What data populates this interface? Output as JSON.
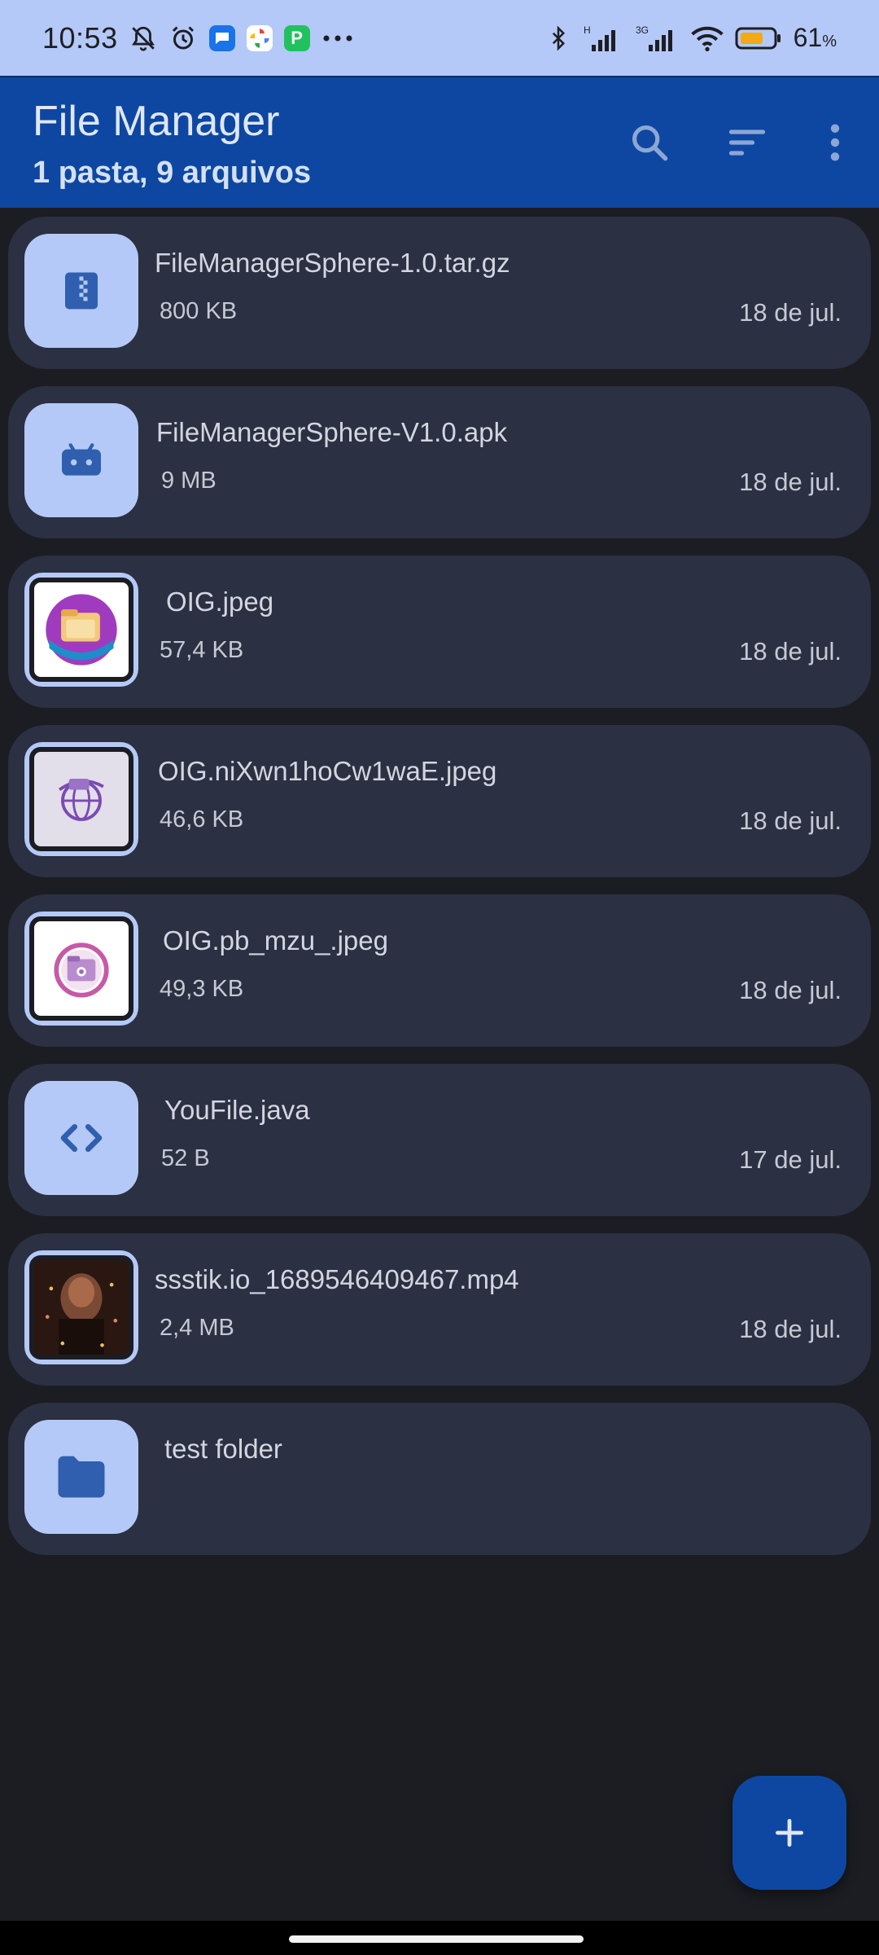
{
  "status_bar": {
    "time": "10:53",
    "battery_percent": "61",
    "battery_unit": "%",
    "icons": [
      "mute-bell-icon",
      "alarm-icon",
      "messages-app-icon",
      "photos-app-icon",
      "picpay-app-icon",
      "more-dots-icon",
      "bluetooth-icon",
      "signal-h-icon",
      "signal-3g-icon",
      "wifi-icon",
      "battery-icon"
    ],
    "signal_labels": {
      "sim1": "H",
      "sim2": "3G"
    },
    "app_badge_label": "P"
  },
  "app_bar": {
    "title": "File Manager",
    "subtitle": "1 pasta, 9 arquivos",
    "actions": [
      "search-icon",
      "sort-icon",
      "overflow-menu-icon"
    ]
  },
  "files": [
    {
      "name": "FileManagerSphere-1.0.tar.gz",
      "size": "800 KB",
      "date": "18 de jul.",
      "icon": "archive-icon"
    },
    {
      "name": "FileManagerSphere-V1.0.apk",
      "size": "9 MB",
      "date": "18 de jul.",
      "icon": "android-icon"
    },
    {
      "name": "OIG.jpeg",
      "size": "57,4 KB",
      "date": "18 de jul.",
      "icon": "image-thumbnail"
    },
    {
      "name": "OIG.niXwn1hoCw1waE.jpeg",
      "size": "46,6 KB",
      "date": "18 de jul.",
      "icon": "image-thumbnail"
    },
    {
      "name": "OIG.pb_mzu_.jpeg",
      "size": "49,3 KB",
      "date": "18 de jul.",
      "icon": "image-thumbnail"
    },
    {
      "name": "YouFile.java",
      "size": "52 B",
      "date": "17 de jul.",
      "icon": "code-icon"
    },
    {
      "name": "ssstik.io_1689546409467.mp4",
      "size": "2,4 MB",
      "date": "18 de jul.",
      "icon": "video-thumbnail"
    },
    {
      "name": "test folder",
      "size": "",
      "date": "",
      "icon": "folder-icon"
    }
  ],
  "fab": {
    "icon": "plus-icon"
  },
  "colors": {
    "status_bar": "#b4c9f7",
    "app_bar": "#0d47a1",
    "background": "#1c1d22",
    "card": "#2b3042",
    "icon_tile": "#b4c9f7",
    "icon_glyph": "#2f5fae"
  }
}
